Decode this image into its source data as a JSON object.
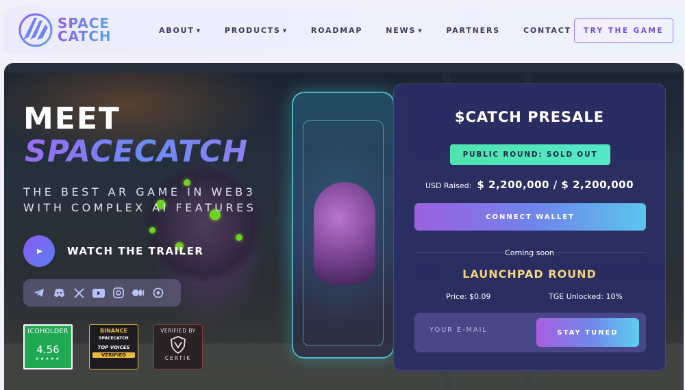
{
  "brand": {
    "line1": "SPACE",
    "line2": "CATCH"
  },
  "nav": {
    "items": [
      {
        "label": "ABOUT",
        "dropdown": true
      },
      {
        "label": "PRODUCTS",
        "dropdown": true
      },
      {
        "label": "ROADMAP",
        "dropdown": false
      },
      {
        "label": "NEWS",
        "dropdown": true
      },
      {
        "label": "PARTNERS",
        "dropdown": false
      },
      {
        "label": "CONTACT",
        "dropdown": false
      }
    ],
    "cta": "TRY THE GAME"
  },
  "hero": {
    "title1": "MEET",
    "title2": "SPACECATCH",
    "subtitle_line1": "THE BEST AR GAME IN WEB3",
    "subtitle_line2": "WITH COMPLEX AI FEATURES",
    "trailer_label": "WATCH THE TRAILER",
    "socials": [
      "telegram-icon",
      "discord-icon",
      "x-icon",
      "youtube-icon",
      "instagram-icon",
      "medium-icon",
      "linktree-icon"
    ]
  },
  "badges": {
    "icoholder": {
      "name": "ICOHOLDER",
      "rating": "4.56",
      "stars": "★★★★★"
    },
    "binance": {
      "brand": "BINANCE",
      "project": "SPACECATCH",
      "tag": "TOP VOICES",
      "status": "VERIFIED"
    },
    "certik": {
      "top": "VERIFIED BY",
      "name": "CERTIK"
    }
  },
  "presale": {
    "title": "$CATCH PRESALE",
    "status": "PUBLIC ROUND: SOLD OUT",
    "raised_label": "USD Raised:",
    "raised_value": "$ 2,200,000 / $ 2,200,000",
    "connect_label": "CONNECT WALLET",
    "coming_soon": "Coming soon",
    "launchpad": "LAUNCHPAD ROUND",
    "price": "Price: $0.09",
    "tge": "TGE Unlocked: 10%",
    "email_placeholder": "YOUR E-MAIL",
    "stay_tuned": "STAY TUNED"
  },
  "colors": {
    "accent_purple": "#8a5cf0",
    "accent_blue": "#5d7ef2",
    "sold_green": "#4fe3b0",
    "launch_gold": "#f0c45a",
    "card_bg": "#2a2e64"
  }
}
